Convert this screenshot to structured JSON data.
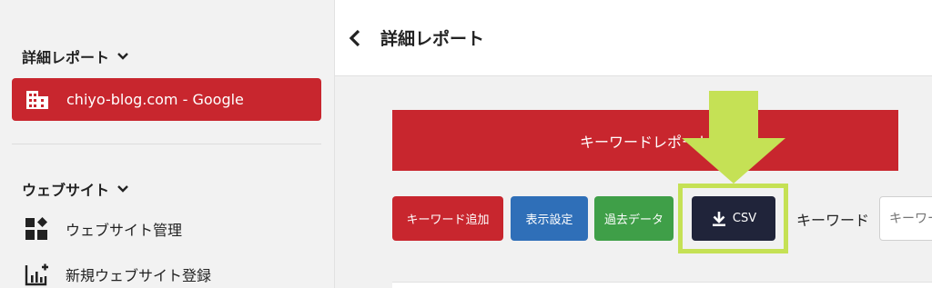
{
  "sidebar": {
    "section1_title": "詳細レポート",
    "active_item": "chiyo-blog.com - Google",
    "section2_title": "ウェブサイト",
    "items": [
      {
        "label": "ウェブサイト管理",
        "icon": "dashboard-icon"
      },
      {
        "label": "新規ウェブサイト登録",
        "icon": "add-chart-icon"
      }
    ]
  },
  "header": {
    "title": "詳細レポート"
  },
  "main": {
    "banner_label": "キーワードレポート",
    "buttons": {
      "add_keyword": "キーワード追加",
      "display_settings": "表示設定",
      "past_data": "過去データ",
      "csv": "CSV"
    },
    "keyword_label": "キーワード",
    "keyword_placeholder": "キーワード"
  },
  "colors": {
    "brand_red": "#c8262e",
    "blue": "#2f6fb8",
    "green": "#3f9f48",
    "dark": "#20243a",
    "highlight": "#c5e155"
  }
}
